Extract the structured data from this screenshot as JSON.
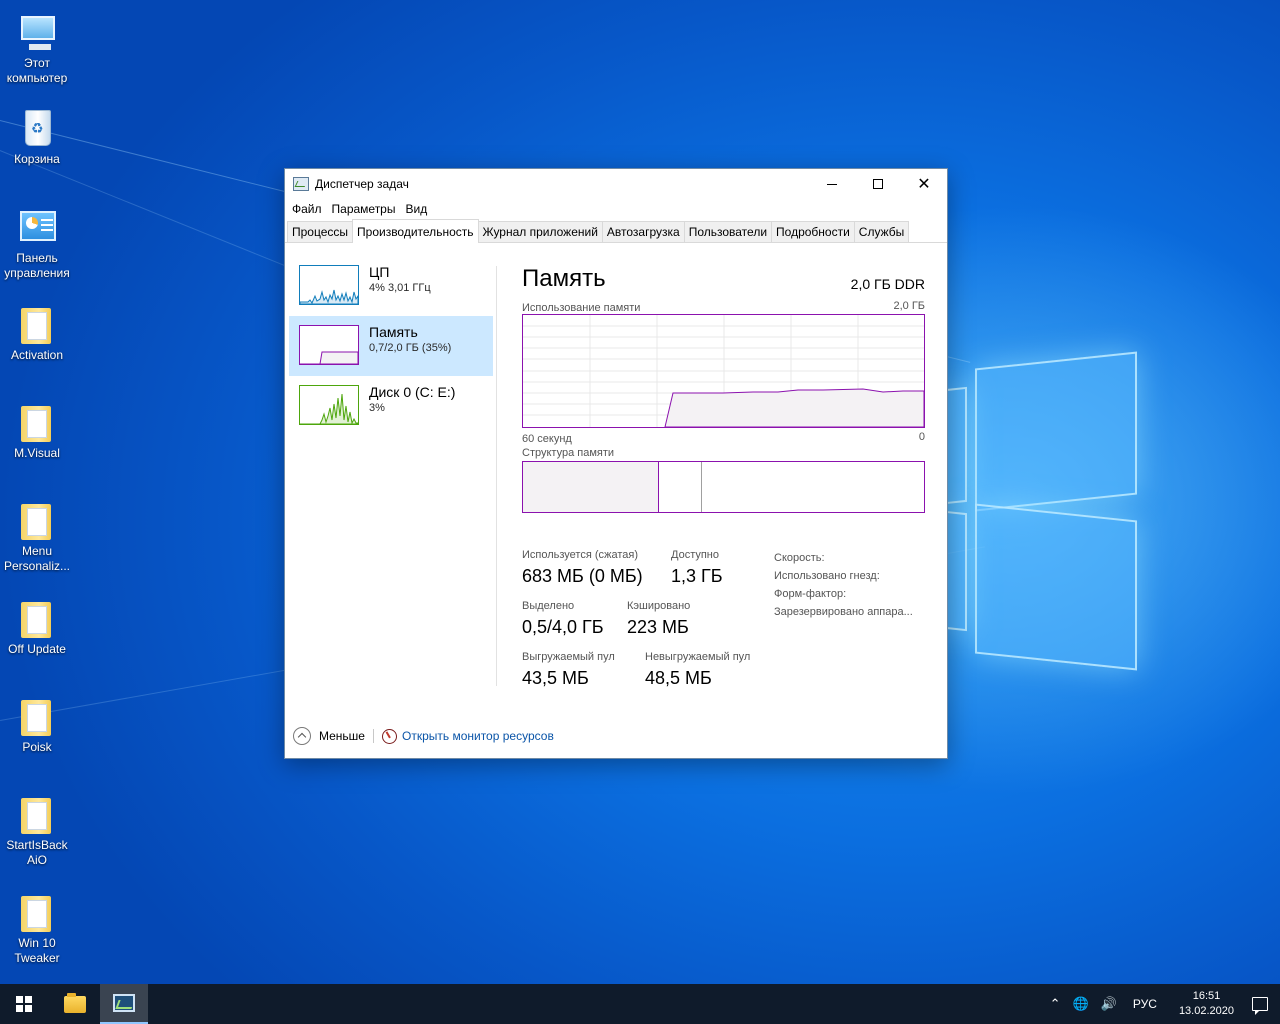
{
  "desktop": {
    "icons": [
      {
        "label": "Этот компьютер",
        "icon": "computer-icon"
      },
      {
        "label": "Корзина",
        "icon": "recycle-bin-icon"
      },
      {
        "label": "Панель управления",
        "icon": "control-panel-icon"
      },
      {
        "label": "Activation",
        "icon": "folder-icon"
      },
      {
        "label": "M.Visual",
        "icon": "folder-icon"
      },
      {
        "label": "Menu Personaliz...",
        "icon": "folder-icon"
      },
      {
        "label": "Off Update",
        "icon": "folder-icon"
      },
      {
        "label": "Poisk",
        "icon": "folder-icon"
      },
      {
        "label": "StartIsBack AiO",
        "icon": "folder-icon"
      },
      {
        "label": "Win 10 Tweaker",
        "icon": "folder-icon"
      }
    ]
  },
  "window": {
    "title": "Диспетчер задач",
    "menu": [
      "Файл",
      "Параметры",
      "Вид"
    ],
    "tabs": [
      "Процессы",
      "Производительность",
      "Журнал приложений",
      "Автозагрузка",
      "Пользователи",
      "Подробности",
      "Службы"
    ],
    "active_tab": "Производительность"
  },
  "resources": [
    {
      "name": "ЦП",
      "sub": "4%  3,01 ГГц",
      "color": "#117dbb"
    },
    {
      "name": "Память",
      "sub": "0,7/2,0 ГБ (35%)",
      "color": "#8b12ae",
      "selected": true
    },
    {
      "name": "Диск 0 (C: E:)",
      "sub": "3%",
      "color": "#4da60c"
    }
  ],
  "memory": {
    "title": "Память",
    "spec": "2,0 ГБ DDR",
    "usage_label": "Использование памяти",
    "usage_max": "2,0 ГБ",
    "time_left": "60 секунд",
    "time_right": "0",
    "composition_label": "Структура памяти",
    "in_use_label": "Используется (сжатая)",
    "in_use_value": "683 МБ (0 МБ)",
    "available_label": "Доступно",
    "available_value": "1,3 ГБ",
    "committed_label": "Выделено",
    "committed_value": "0,5/4,0 ГБ",
    "cached_label": "Кэшировано",
    "cached_value": "223 МБ",
    "paged_label": "Выгружаемый пул",
    "paged_value": "43,5 МБ",
    "nonpaged_label": "Невыгружаемый пул",
    "nonpaged_value": "48,5 МБ",
    "speed_label": "Скорость:",
    "slots_label": "Использовано гнезд:",
    "form_label": "Форм-фактор:",
    "reserved_label": "Зарезервировано аппара...",
    "colors": {
      "line": "#8b12ae",
      "fill": "#f4f2f4",
      "grid": "#e8e8e8"
    }
  },
  "footer": {
    "less": "Меньше",
    "monitor_link": "Открыть монитор ресурсов"
  },
  "taskbar": {
    "language": "РУС",
    "time": "16:51",
    "date": "13.02.2020"
  }
}
